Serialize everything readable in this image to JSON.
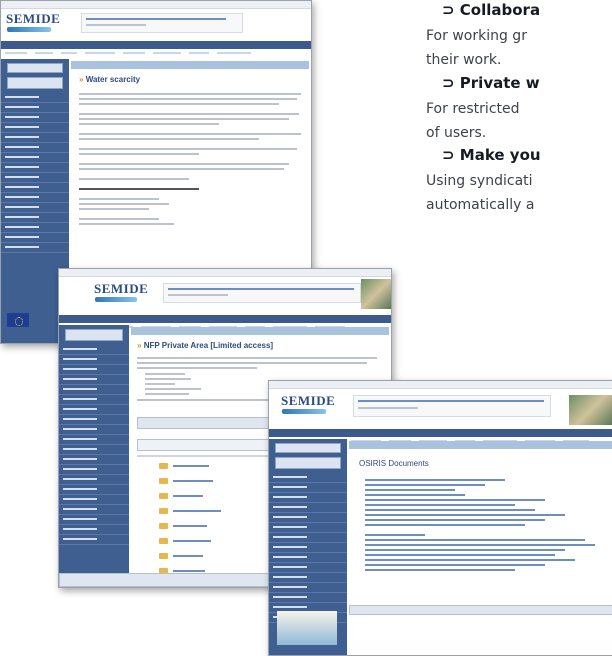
{
  "feature_list": {
    "items": [
      {
        "title": "⊃ Collabora",
        "description_lines": [
          "For working gr",
          "their work."
        ]
      },
      {
        "title": "⊃ Private w",
        "description_lines": [
          "For restricted",
          "of users."
        ]
      },
      {
        "title": "⊃ Make you",
        "description_lines": [
          "Using syndicati",
          "automatically a"
        ]
      }
    ]
  },
  "screenshots": {
    "water_scarcity": {
      "logo": "SEMIDE",
      "page_title_prefix": "»",
      "page_title": "Water scarcity"
    },
    "nfp_private_area": {
      "logo": "SEMIDE",
      "page_title_prefix": "»",
      "page_title": "NFP Private Area [Limited access]",
      "folder_count": 8
    },
    "osiris_documents": {
      "logo": "SEMIDE",
      "page_title": "OSIRIS Documents"
    }
  },
  "colors": {
    "brand_blue": "#2b4a86",
    "nav_blue": "#3d5a8c",
    "accent_orange": "#e08a1e"
  }
}
